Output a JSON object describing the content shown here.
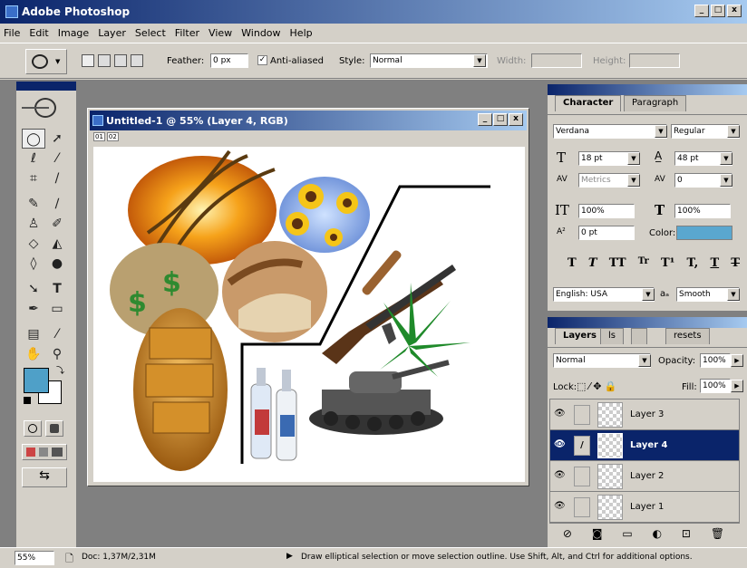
{
  "app": {
    "title": "Adobe Photoshop"
  },
  "menu": [
    "File",
    "Edit",
    "Image",
    "Layer",
    "Select",
    "Filter",
    "View",
    "Window",
    "Help"
  ],
  "options": {
    "feather_label": "Feather:",
    "feather_value": "0 px",
    "antialias_label": "Anti-aliased",
    "style_label": "Style:",
    "style_value": "Normal",
    "width_label": "Width:",
    "height_label": "Height:"
  },
  "document": {
    "title": "Untitled-1 @ 55% (Layer 4, RGB)",
    "ruler_tabs": [
      "01",
      "02"
    ]
  },
  "character": {
    "tabs": [
      "Character",
      "Paragraph"
    ],
    "font": "Verdana",
    "style": "Regular",
    "size": "18 pt",
    "leading": "48 pt",
    "kerning": "Metrics",
    "tracking": "0",
    "vscale": "100%",
    "hscale": "100%",
    "baseline": "0 pt",
    "color_label": "Color:",
    "color": "#5aa7cf",
    "language": "English: USA",
    "aa_glyph": "aₐ",
    "antialias": "Smooth",
    "type_buttons": [
      "T",
      "T",
      "TT",
      "Tr",
      "T¹",
      "T,",
      "T",
      "T"
    ]
  },
  "layers": {
    "tabs": [
      "Layers",
      "ls",
      "",
      "resets"
    ],
    "blend": "Normal",
    "opacity_label": "Opacity:",
    "opacity": "100%",
    "lock_label": "Lock:",
    "fill_label": "Fill:",
    "fill": "100%",
    "items": [
      {
        "name": "Layer 3",
        "selected": false
      },
      {
        "name": "Layer 4",
        "selected": true
      },
      {
        "name": "Layer 2",
        "selected": false
      },
      {
        "name": "Layer 1",
        "selected": false
      }
    ]
  },
  "toolbox": {
    "fg_color": "#4fa0c8",
    "bg_color": "#ffffff"
  },
  "status": {
    "zoom": "55%",
    "doc": "Doc: 1,37M/2,31M",
    "hint": "Draw elliptical selection or move selection outline. Use Shift, Alt, and Ctrl for additional options."
  }
}
